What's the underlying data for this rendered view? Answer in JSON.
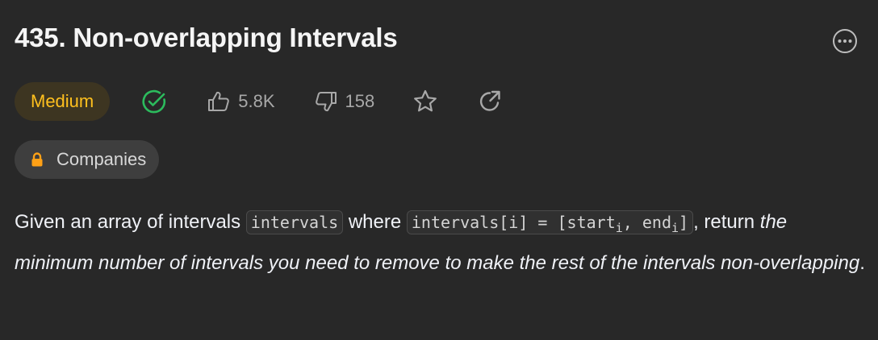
{
  "problem": {
    "title": "435. Non-overlapping Intervals"
  },
  "meta": {
    "difficulty": "Medium",
    "likes": "5.8K",
    "dislikes": "158",
    "companies_label": "Companies"
  },
  "description": {
    "text_1": "Given an array of intervals ",
    "code_1": "intervals",
    "text_2": " where ",
    "code_2_pre": "intervals[i] = [start",
    "code_2_sub1": "i",
    "code_2_mid": ", end",
    "code_2_sub2": "i",
    "code_2_post": "]",
    "text_3": ", return ",
    "emphasis_1": "the minimum number of intervals you need to remove to make the rest of the intervals non-overlapping",
    "text_4": "."
  },
  "colors": {
    "background": "#282828",
    "difficulty_text": "#ffc01e",
    "difficulty_bg": "#3d3521",
    "solved_green": "#2cbb5d"
  },
  "icons": {
    "more": "more-horizontal-icon",
    "solved": "check-circle-icon",
    "like": "thumbs-up-icon",
    "dislike": "thumbs-down-icon",
    "star": "star-icon",
    "share": "share-icon",
    "lock": "lock-icon"
  }
}
